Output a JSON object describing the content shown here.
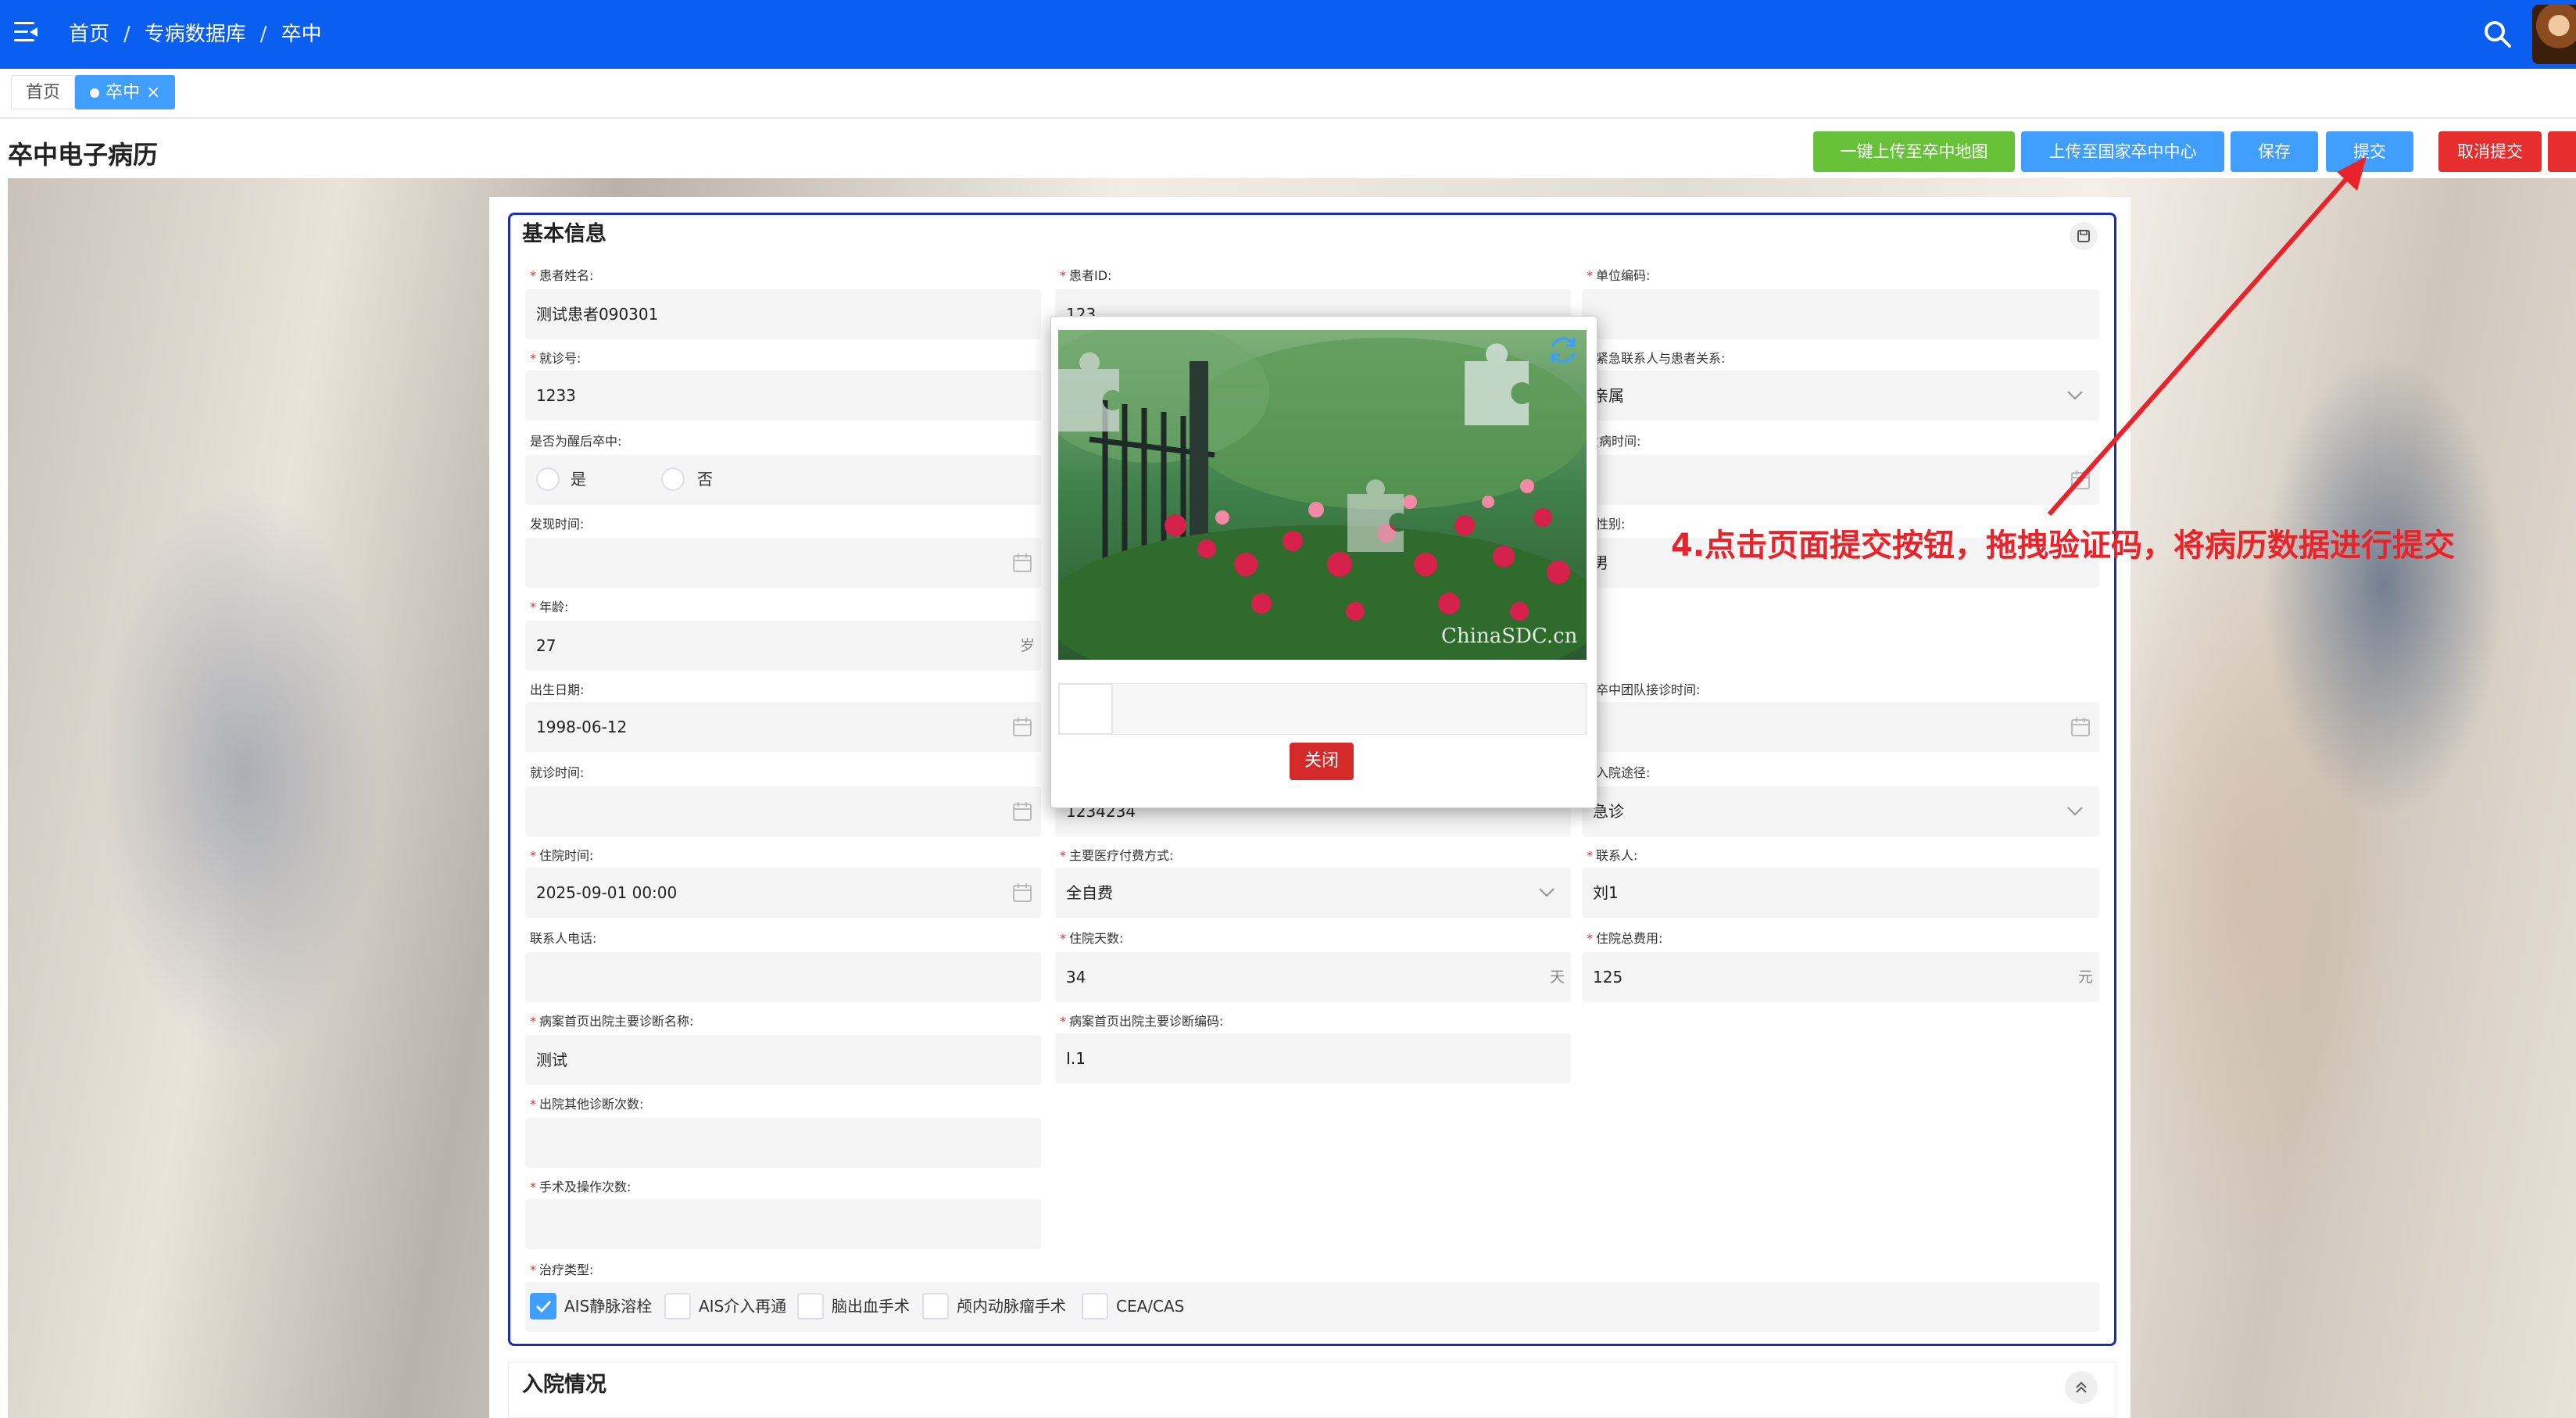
{
  "header": {
    "breadcrumb": [
      "首页",
      "专病数据库",
      "卒中"
    ],
    "separator": "/"
  },
  "tabs": [
    {
      "label": "首页",
      "active": false
    },
    {
      "label": "卒中",
      "active": true
    }
  ],
  "page": {
    "title": "卒中电子病历",
    "buttons": {
      "upload_map": "一键上传至卒中地图",
      "upload_national": "上传至国家卒中中心",
      "save": "保存",
      "submit": "提交",
      "cancel_submit": "取消提交"
    }
  },
  "section_basic": {
    "title": "基本信息",
    "fields": {
      "patient_name": {
        "label": "患者姓名:",
        "value": "测试患者090301"
      },
      "patient_id": {
        "label": "患者ID:",
        "value": "123"
      },
      "unit_code": {
        "label": "单位编码:",
        "value": ""
      },
      "visit_no": {
        "label": "就诊号:",
        "value": "1233"
      },
      "emergency_relation": {
        "label": "紧急联系人与患者关系:",
        "value": "亲属"
      },
      "wake_stroke": {
        "label": "是否为醒后卒中:",
        "options": [
          "是",
          "否"
        ]
      },
      "onset_time": {
        "label": "发病时间:",
        "value": ""
      },
      "found_time": {
        "label": "发现时间:",
        "value": ""
      },
      "gender": {
        "label": "性别:",
        "value": "男"
      },
      "age": {
        "label": "年龄:",
        "value": "27",
        "unit": "岁"
      },
      "birth_date": {
        "label": "出生日期:",
        "value": "1998-06-12"
      },
      "team_time": {
        "label": "卒中团队接诊时间:",
        "value": ""
      },
      "visit_time": {
        "label": "就诊时间:",
        "value": ""
      },
      "mid_value": {
        "value": "1234234"
      },
      "admission_route": {
        "label": "入院途径:",
        "value": "急诊"
      },
      "admission_time": {
        "label": "住院时间:",
        "value": "2025-09-01 00:00"
      },
      "payment": {
        "label": "主要医疗付费方式:",
        "value": "全自费"
      },
      "contact": {
        "label": "联系人:",
        "value": "刘1"
      },
      "contact_phone": {
        "label": "联系人电话:",
        "value": ""
      },
      "stay_days": {
        "label": "住院天数:",
        "value": "34",
        "unit": "天"
      },
      "total_cost": {
        "label": "住院总费用:",
        "value": "125",
        "unit": "元"
      },
      "diag_name": {
        "label": "病案首页出院主要诊断名称:",
        "value": "测试"
      },
      "diag_code": {
        "label": "病案首页出院主要诊断编码:",
        "value": "I.1"
      },
      "other_diag_count": {
        "label": "出院其他诊断次数:",
        "value": ""
      },
      "surgery_count": {
        "label": "手术及操作次数:",
        "value": ""
      },
      "treatment_type": {
        "label": "治疗类型:",
        "options": [
          {
            "label": "AIS静脉溶栓",
            "checked": true
          },
          {
            "label": "AIS介入再通",
            "checked": false
          },
          {
            "label": "脑出血手术",
            "checked": false
          },
          {
            "label": "颅内动脉瘤手术",
            "checked": false
          },
          {
            "label": "CEA/CAS",
            "checked": false
          }
        ]
      }
    }
  },
  "section_admission": {
    "title": "入院情况"
  },
  "captcha": {
    "watermark": "ChinaSDC.cn",
    "close_label": "关闭",
    "slider_value": 0
  },
  "annotation": "4.点击页面提交按钮，拖拽验证码，将病历数据进行提交",
  "colors": {
    "topbar": "#0a5ef0",
    "primary": "#409eff",
    "success": "#67c23a",
    "danger": "#e62e2e",
    "section_border": "#1a2fb0",
    "annotation": "#e8232a"
  }
}
